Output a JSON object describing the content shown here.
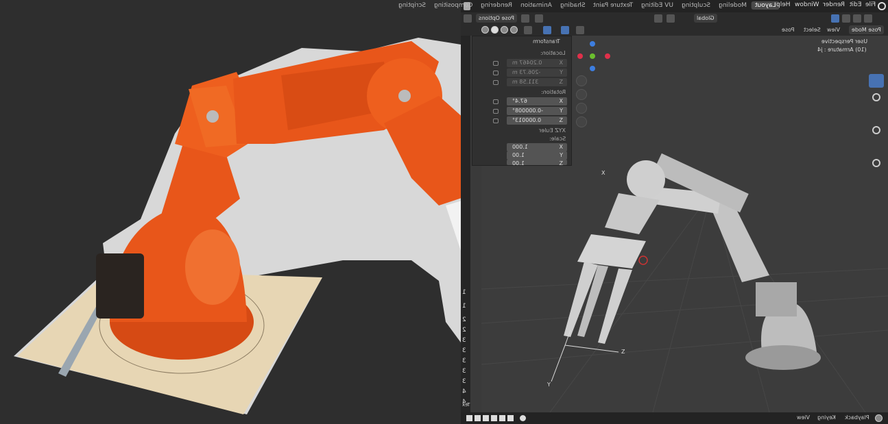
{
  "topbar": {
    "tabs": [
      "Layout",
      "Modeling",
      "Sculpting",
      "UV Editing",
      "Texture Paint",
      "Shading",
      "Animation",
      "Rendering",
      "Compositing",
      "Scripting"
    ],
    "active_tab": "Layout",
    "menus": [
      "File",
      "Edit",
      "Render",
      "Window",
      "Help"
    ]
  },
  "header2": {
    "transform_orientation": "Global",
    "pose_options": "Pose Options"
  },
  "header3": {
    "mode": "Pose Mode",
    "menus": [
      "View",
      "Select",
      "Pose"
    ]
  },
  "npanel": {
    "title": "Transform",
    "location_label": "Location:",
    "location": [
      {
        "axis": "X",
        "value": "0.20467 m"
      },
      {
        "axis": "Y",
        "value": "-206.73 m"
      },
      {
        "axis": "Z",
        "value": "311.58 m"
      }
    ],
    "rotation_label": "Rotation:",
    "rotation": [
      {
        "axis": "X",
        "value": "67.4°"
      },
      {
        "axis": "Y",
        "value": "-0.000008°"
      },
      {
        "axis": "Z",
        "value": "0.000013°"
      }
    ],
    "rotation_mode": "XYZ Euler",
    "scale_label": "Scale:",
    "scale": [
      {
        "axis": "X",
        "value": "1.000"
      },
      {
        "axis": "Y",
        "value": "1.00"
      },
      {
        "axis": "Z",
        "value": "1.00"
      }
    ],
    "side_tabs": [
      "Item",
      "Tool"
    ]
  },
  "viewport": {
    "perspective": "User Perspective",
    "object": "(10) Armature : j4",
    "axis_x": "X",
    "axis_y": "Y",
    "axis_z": "Z"
  },
  "timeline_numbers": [
    "1",
    "1",
    "2",
    "2",
    "3",
    "3",
    "3",
    "3",
    "3",
    "4",
    "4"
  ],
  "sidebar_label": "Tex",
  "bottombar": {
    "playback": "Playback",
    "keying": "Keying",
    "view": "View"
  },
  "colors": {
    "active_blue": "#4772b3",
    "robot_orange": "#e8561a",
    "gizmo_red": "#e0304a",
    "gizmo_green": "#6bbf2e",
    "gizmo_blue": "#3d7ee0"
  }
}
